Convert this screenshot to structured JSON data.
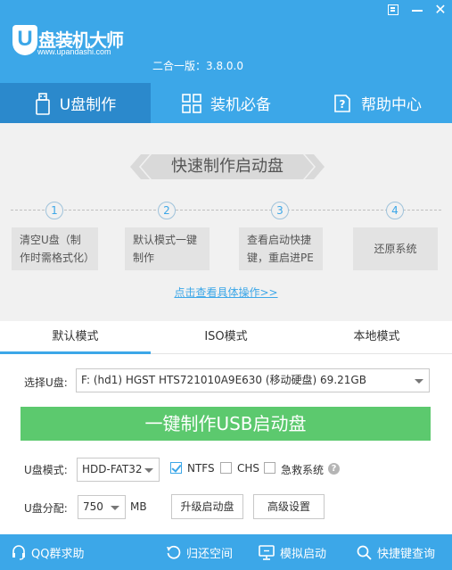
{
  "app": {
    "logo_letter": "U",
    "logo_title": "盘装机大师",
    "logo_url": "www.upandashi.com",
    "version": "二合一版：3.8.0.0"
  },
  "nav": {
    "tabs": [
      {
        "label": "U盘制作",
        "icon": "usb-drive-icon"
      },
      {
        "label": "装机必备",
        "icon": "app-grid-icon"
      },
      {
        "label": "帮助中心",
        "icon": "help-document-icon"
      }
    ]
  },
  "content": {
    "banner": "快速制作启动盘",
    "steps": [
      {
        "num": "1",
        "text": "清空U盘（制作时需格式化）"
      },
      {
        "num": "2",
        "text": "默认模式一键制作"
      },
      {
        "num": "3",
        "text": "查看启动快捷键，重启进PE"
      },
      {
        "num": "4",
        "text": "还原系统"
      }
    ],
    "detail_link": "点击查看具体操作>>"
  },
  "modes": {
    "tabs": [
      "默认模式",
      "ISO模式",
      "本地模式"
    ],
    "active": "默认模式"
  },
  "form": {
    "disk_label": "选择U盘:",
    "disk_value": "F: (hd1) HGST HTS721010A9E630 (移动硬盘) 69.21GB",
    "make_button": "一键制作USB启动盘",
    "mode_label": "U盘模式:",
    "mode_value": "HDD-FAT32",
    "options": [
      {
        "label": "NTFS",
        "checked": true
      },
      {
        "label": "CHS",
        "checked": false
      },
      {
        "label": "急救系统",
        "checked": false
      }
    ],
    "help_glyph": "?",
    "partition_label": "U盘分配:",
    "partition_value": "750",
    "partition_unit": "MB",
    "upgrade_button": "升级启动盘",
    "advanced_button": "高级设置"
  },
  "footer": {
    "items": [
      {
        "label": "QQ群求助",
        "icon": "headset-icon"
      },
      {
        "label": "归还空间",
        "icon": "restore-icon"
      },
      {
        "label": "模拟启动",
        "icon": "monitor-icon"
      },
      {
        "label": "快捷键查询",
        "icon": "search-icon"
      }
    ]
  },
  "colors": {
    "primary": "#3ca7e8",
    "nav_active": "#2b89cc",
    "make_button": "#5cc96e",
    "content_bg": "#f1f1f1"
  }
}
